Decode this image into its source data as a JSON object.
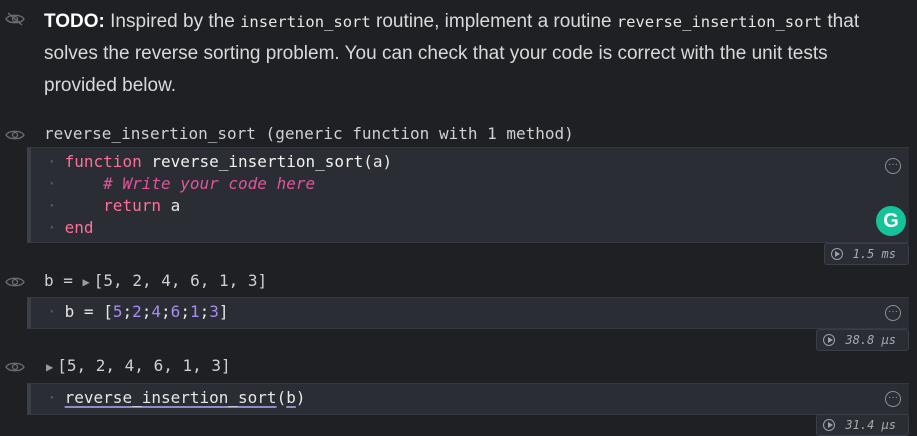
{
  "markdown": {
    "bold": "TODO:",
    "part1": " Inspired by the ",
    "code1": "insertion_sort",
    "part2": " routine, implement a routine ",
    "code2": "reverse_insertion_sort",
    "part3": " that solves the reverse sorting problem. You can check that your code is correct with the unit tests provided below."
  },
  "cell1": {
    "output": "reverse_insertion_sort (generic function with 1 method)",
    "code": {
      "kw_function": "function",
      "fname": "reverse_insertion_sort",
      "args": "(a)",
      "comment": "# Write your code here",
      "kw_return": "return",
      "ret_val": "a",
      "kw_end": "end"
    },
    "timing": "1.5 ms",
    "grammarly": "G"
  },
  "cell2": {
    "output_prefix": "b =",
    "output_value": "[5, 2, 4, 6, 1, 3]",
    "code": {
      "lhs": "b",
      "eq": "=",
      "values": [
        "5",
        "2",
        "4",
        "6",
        "1",
        "3"
      ]
    },
    "timing": "38.8 μs"
  },
  "cell3": {
    "output_value": "[5, 2, 4, 6, 1, 3]",
    "code": {
      "call": "reverse_insertion_sort",
      "arg": "b"
    },
    "timing": "31.4 μs"
  },
  "icons": {
    "eye": "eye-icon",
    "eye_off": "eye-off-icon",
    "more": "more-options-icon",
    "play": "run-icon",
    "grammarly": "grammarly-icon"
  }
}
